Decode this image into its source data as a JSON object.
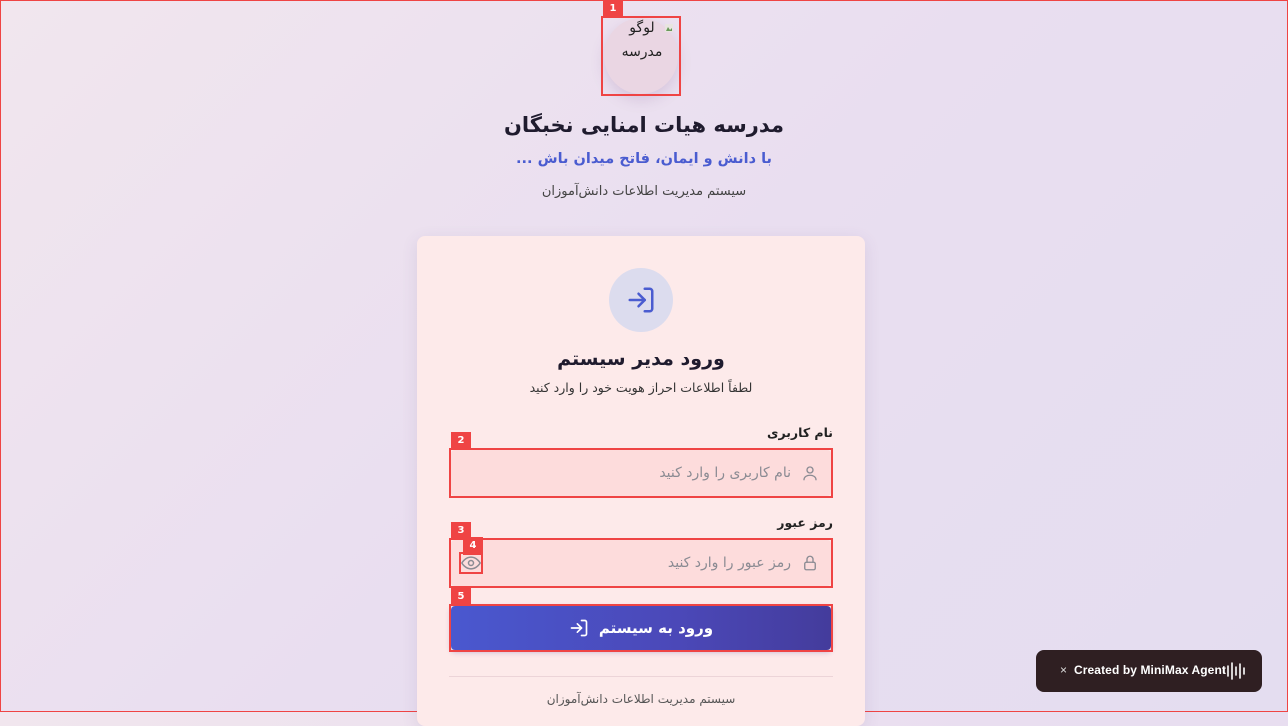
{
  "header": {
    "logo_alt": "لوگو مدرسه",
    "school_name": "مدرسه هیات امنایی نخبگان",
    "motto": "با دانش و ایمان، فاتح میدان باش ...",
    "system_name": "سیستم مدیریت اطلاعات دانش‌آموزان"
  },
  "login_card": {
    "icon": "login-icon",
    "title": "ورود مدیر سیستم",
    "subtitle": "لطفاً اطلاعات احراز هویت خود را وارد کنید",
    "username": {
      "label": "نام کاربری",
      "placeholder": "نام کاربری را وارد کنید",
      "value": "",
      "icon": "user-icon"
    },
    "password": {
      "label": "رمز عبور",
      "placeholder": "رمز عبور را وارد کنید",
      "value": "",
      "icon": "lock-icon",
      "toggle_icon": "eye-icon"
    },
    "submit_label": "ورود به سیستم",
    "footer": "سیستم مدیریت اطلاعات دانش‌آموزان"
  },
  "toast": {
    "close": "×",
    "text": "Created by MiniMax Agent"
  },
  "annotations": [
    "1",
    "2",
    "3",
    "4",
    "5"
  ],
  "colors": {
    "accent": "#4a5cd0",
    "button": "#4b48b8",
    "highlight": "#ef4444",
    "card_bg": "#fdeaea",
    "input_bg": "#fddcdc"
  }
}
